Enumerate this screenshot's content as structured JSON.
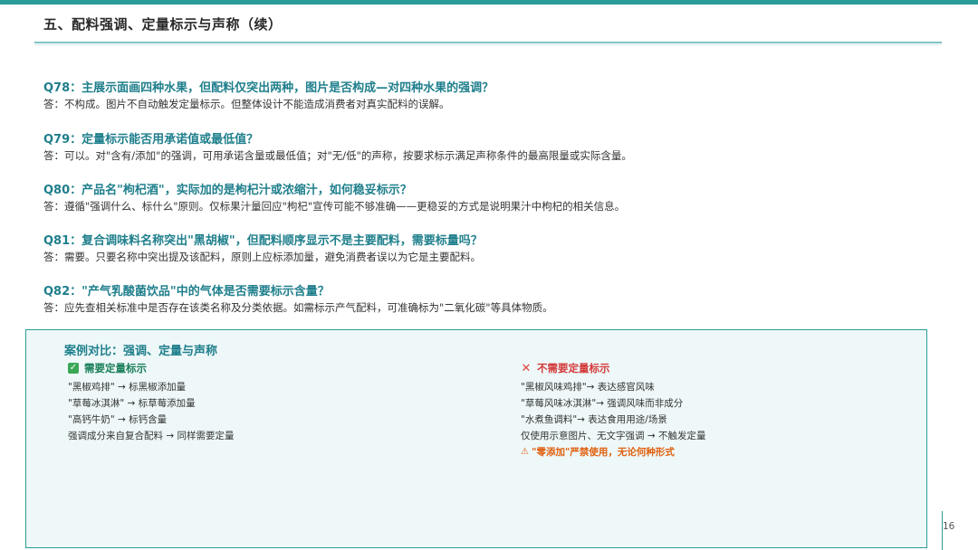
{
  "header": {
    "title": "五、配料强调、定量标示与声称（续）"
  },
  "qa": [
    {
      "q": "Q78：主展示面画四种水果，但配料仅突出两种，图片是否构成—对四种水果的强调？",
      "a": "答：不构成。图片不自动触发定量标示。但整体设计不能造成消费者对真实配料的误解。"
    },
    {
      "q": "Q79：定量标示能否用承诺值或最低值？",
      "a": "答：可以。对\"含有/添加\"的强调，可用承诺含量或最低值；对\"无/低\"的声称，按要求标示满足声称条件的最高限量或实际含量。"
    },
    {
      "q": "Q80：产品名\"枸杞酒\"，实际加的是枸杞汁或浓缩汁，如何稳妥标示？",
      "a": "答：遵循\"强调什么、标什么\"原则。仅标果汁量回应\"枸杞\"宣传可能不够准确——更稳妥的方式是说明果汁中枸杞的相关信息。"
    },
    {
      "q": "Q81：复合调味料名称突出\"黑胡椒\"，但配料顺序显示不是主要配料，需要标量吗？",
      "a": "答：需要。只要名称中突出提及该配料，原则上应标添加量，避免消费者误以为它是主要配料。"
    },
    {
      "q": "Q82：\"产气乳酸菌饮品\"中的气体是否需要标示含量？",
      "a": "答：应先查相关标准中是否存在该类名称及分类依据。如需标示产气配料，可准确标为\"二氧化碳\"等具体物质。"
    }
  ],
  "case": {
    "title": "案例对比：强调、定量与声称",
    "left": {
      "heading": "需要定量标示",
      "icon": "check-icon",
      "items": [
        "\"黑椒鸡排\" → 标黑椒添加量",
        "\"草莓冰淇淋\" → 标草莓添加量",
        "\"高钙牛奶\" → 标钙含量",
        "强调成分来自复合配料 → 同样需要定量"
      ]
    },
    "right": {
      "heading": "不需要定量标示",
      "icon": "cross-icon",
      "items": [
        "\"黑椒风味鸡排\"→ 表达感官风味",
        "\"草莓风味冰淇淋\"→ 强调风味而非成分",
        "\"水煮鱼调料\"→ 表达食用用途/场景",
        "仅使用示意图片、无文字强调 → 不触发定量"
      ],
      "warning": "\"零添加\"严禁使用，无论何种形式",
      "warning_icon": "warning-icon"
    }
  },
  "footer": {
    "page_number": "16"
  },
  "colors": {
    "accent": "#2a9d9a",
    "question": "#1f7f8c",
    "ok": "#1a7f5a",
    "no": "#d43a3a",
    "warn": "#e06010"
  }
}
